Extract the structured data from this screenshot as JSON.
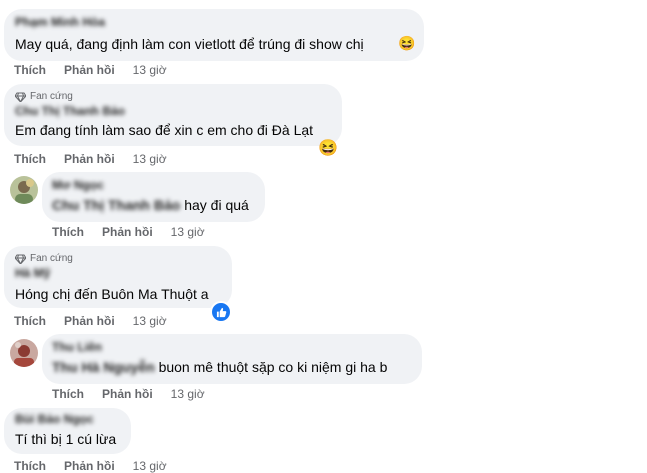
{
  "colors": {
    "bubble": "#f0f2f5",
    "secondary_text": "#65676b",
    "like_blue": "#1877f2"
  },
  "actions": {
    "like": "Thích",
    "reply": "Phản hồi"
  },
  "comments": [
    {
      "author": "Phạm Minh Hòa",
      "badge": "",
      "text": "May quá, đang định làm con vietlott để trúng đi show chị",
      "emoji": "😆",
      "time": "13 giờ"
    },
    {
      "author": "Chu Thị Thanh Bảo",
      "badge": "Fan cứng",
      "text": "Em đang tính làm sao để xin c em cho đi Đà Lạt",
      "emoji": "😆",
      "time": "13 giờ"
    },
    {
      "author": "Mơ Ngọc",
      "mention": "Chu Thị Thanh Bảo",
      "badge": "",
      "text": "hay đi quá",
      "time": "13 giờ",
      "avatar_icon": "user-photo-icon"
    },
    {
      "author": "Hà Mỹ",
      "badge": "Fan cứng",
      "text": "Hóng chị đến Buôn Ma Thuột a",
      "reaction": "like-icon",
      "time": "13 giờ"
    },
    {
      "author": "Thu Liên",
      "mention": "Thu Hà Nguyễn",
      "badge": "",
      "text": "buon mê thuột sặp co ki niệm gi ha b",
      "time": "13 giờ",
      "avatar_icon": "user-photo-icon"
    },
    {
      "author": "Bùi Bảo Ngọc",
      "badge": "",
      "text": "Tí thì bị 1 cú lừa",
      "time": "13 giờ"
    }
  ]
}
